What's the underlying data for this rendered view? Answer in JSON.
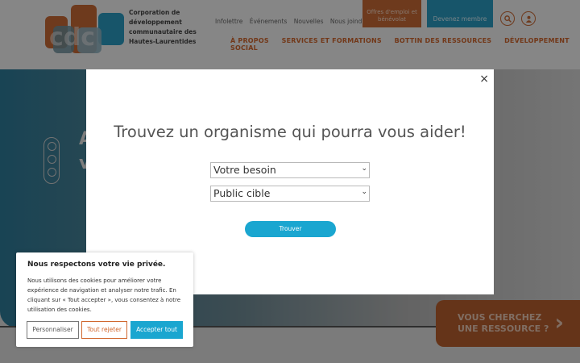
{
  "header": {
    "org_name": "Corporation de développement communautaire des Hautes-Laurentides",
    "topnav": [
      "Infolettre",
      "Événements",
      "Nouvelles",
      "Nous joindre"
    ],
    "jobs_button": "Offres d'emploi et bénévolat",
    "member_button": "Devenez membre",
    "mainnav": [
      "À PROPOS",
      "SERVICES ET FORMATIONS",
      "BOTTIN DES RESSOURCES",
      "DÉVELOPPEMENT SOCIAL"
    ],
    "logo_text": "cdc"
  },
  "hero": {
    "text_line1": "A",
    "text_line2": "v",
    "cta_line1": "VOUS CHERCHEZ",
    "cta_line2": "UNE RESSOURCE ?"
  },
  "modal": {
    "close_glyph": "×",
    "title": "Trouvez un organisme qui pourra vous aider!",
    "select_need": "Votre besoin",
    "select_audience": "Public cible",
    "find_button": "Trouver"
  },
  "cookie": {
    "title": "Nous respectons votre vie privée.",
    "text": "Nous utilisons des cookies pour améliorer votre expérience de navigation et analyser notre trafic. En cliquant sur « Tout accepter », vous consentez à notre utilisation des cookies.",
    "customize": "Personnaliser",
    "reject": "Tout rejeter",
    "accept": "Accepter tout"
  },
  "colors": {
    "brand_orange": "#d0672e",
    "brand_blue": "#2a9bc1",
    "button_cyan": "#1aa6d0"
  }
}
